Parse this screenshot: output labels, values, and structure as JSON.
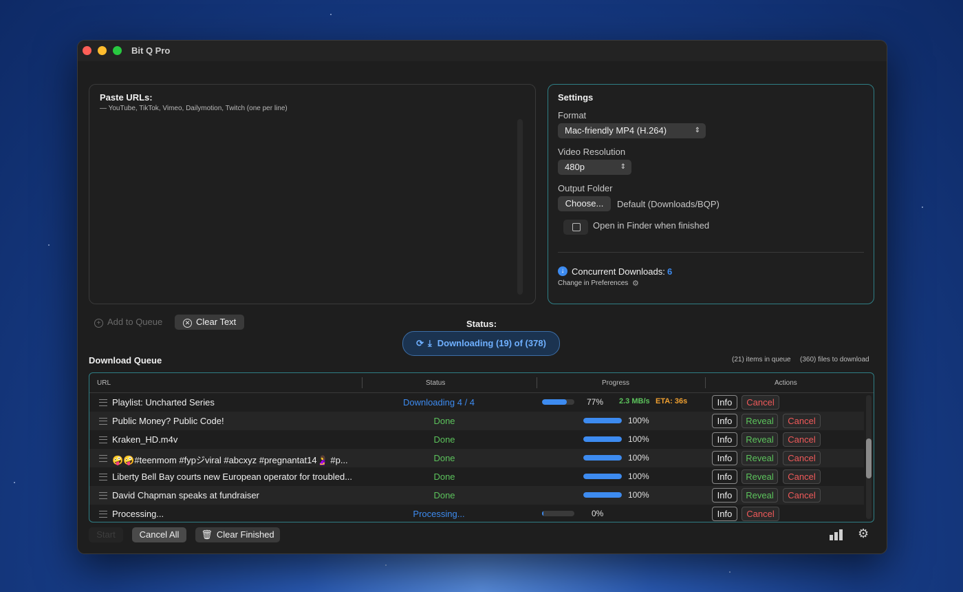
{
  "app": {
    "title": "Bit Q Pro"
  },
  "paste": {
    "heading": "Paste URLs:",
    "hint": "— YouTube, TikTok, Vimeo, Dailymotion, Twitch (one per line)"
  },
  "settings": {
    "heading": "Settings",
    "format_label": "Format",
    "format_value": "Mac-friendly MP4 (H.264)",
    "resolution_label": "Video Resolution",
    "resolution_value": "480p",
    "output_label": "Output Folder",
    "choose_label": "Choose...",
    "output_value": "Default (Downloads/BQP)",
    "open_finder_label": "Open in Finder when finished",
    "open_finder_checked": false,
    "concurrent_label": "Concurrent Downloads:",
    "concurrent_value": "6",
    "change_pref": "Change in Preferences"
  },
  "actions": {
    "add_queue": "Add to Queue",
    "clear_text": "Clear Text"
  },
  "status": {
    "label": "Status:",
    "value": "Downloading (19) of (378)"
  },
  "queue": {
    "title": "Download Queue",
    "items_in_queue": "(21) items in queue",
    "files_to_download": "(360) files to download",
    "columns": {
      "url": "URL",
      "status": "Status",
      "progress": "Progress",
      "actions": "Actions"
    },
    "rows": [
      {
        "url": "Playlist: Uncharted Series",
        "status": "Downloading 4 / 4",
        "status_kind": "downloading",
        "progress": 0.77,
        "pct": "77%",
        "speed": "2.3 MB/s",
        "eta": "ETA: 36s",
        "reveal": false
      },
      {
        "url": "Public Money? Public Code!",
        "status": "Done",
        "status_kind": "done",
        "progress": 1.0,
        "pct": "100%",
        "reveal": true
      },
      {
        "url": "Kraken_HD.m4v",
        "status": "Done",
        "status_kind": "done",
        "progress": 1.0,
        "pct": "100%",
        "reveal": true
      },
      {
        "url": "🤪🤪#teenmom #fypジviral #abcxyz #pregnantat14🤰 #p...",
        "status": "Done",
        "status_kind": "done",
        "progress": 1.0,
        "pct": "100%",
        "reveal": true
      },
      {
        "url": "Liberty Bell Bay courts new European operator for troubled...",
        "status": "Done",
        "status_kind": "done",
        "progress": 1.0,
        "pct": "100%",
        "reveal": true
      },
      {
        "url": "David Chapman speaks at fundraiser",
        "status": "Done",
        "status_kind": "done",
        "progress": 1.0,
        "pct": "100%",
        "reveal": true
      },
      {
        "url": "Processing...",
        "status": "Processing...",
        "status_kind": "processing",
        "progress": 0.05,
        "pct": "0%",
        "reveal": false
      }
    ],
    "info_label": "Info",
    "reveal_label": "Reveal",
    "cancel_label": "Cancel"
  },
  "footer": {
    "start": "Start",
    "cancel_all": "Cancel All",
    "clear_finished": "Clear Finished"
  },
  "colors": {
    "accent": "#3d8bf0",
    "done": "#5cc35c",
    "cancel": "#f05a5a",
    "eta": "#f0a030",
    "panel_border": "#2f7f86"
  }
}
